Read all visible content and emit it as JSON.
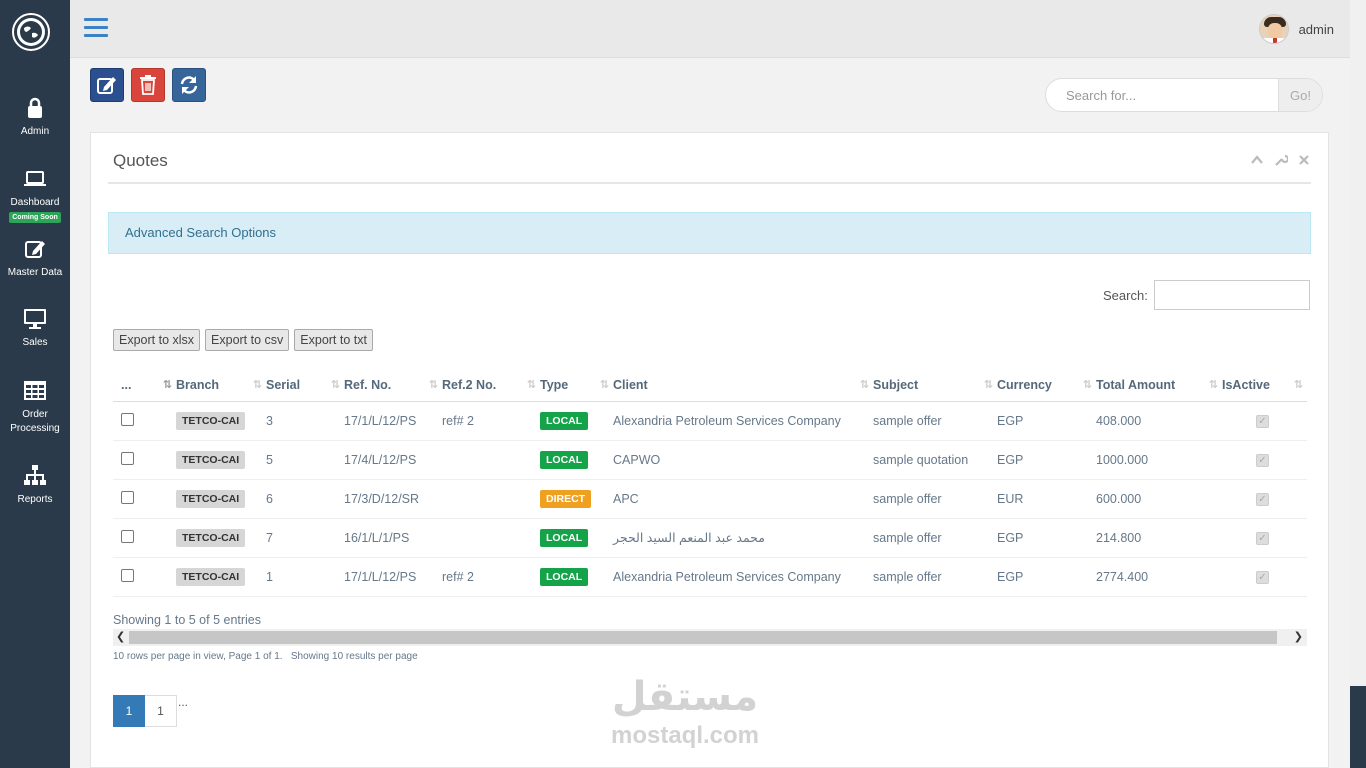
{
  "sidebar": {
    "items": [
      {
        "label": "Admin",
        "icon": "lock-icon"
      },
      {
        "label": "Dashboard",
        "badge": "Coming Soon",
        "icon": "laptop-icon"
      },
      {
        "label": "Master Data",
        "icon": "edit-icon"
      },
      {
        "label": "Sales",
        "icon": "monitor-icon"
      },
      {
        "label": "Order Processing",
        "icon": "table-icon"
      },
      {
        "label": "Reports",
        "icon": "sitemap-icon"
      }
    ]
  },
  "topbar": {
    "username": "admin"
  },
  "search": {
    "placeholder": "Search for...",
    "go_label": "Go!"
  },
  "panel": {
    "title": "Quotes",
    "advanced_search": "Advanced Search Options",
    "table_search_label": "Search:",
    "exports": [
      "Export to xlsx",
      "Export to csv",
      "Export to txt"
    ]
  },
  "table": {
    "columns": [
      "...",
      "Branch",
      "Serial",
      "Ref. No.",
      "Ref.2 No.",
      "Type",
      "Client",
      "Subject",
      "Currency",
      "Total Amount",
      "IsActive"
    ],
    "rows": [
      {
        "branch": "TETCO-CAI",
        "serial": "3",
        "ref": "17/1/L/12/PS",
        "ref2": "ref# 2",
        "type": "LOCAL",
        "client": "Alexandria Petroleum Services Company",
        "subject": "sample offer",
        "currency": "EGP",
        "total": "408.000"
      },
      {
        "branch": "TETCO-CAI",
        "serial": "5",
        "ref": "17/4/L/12/PS",
        "ref2": "",
        "type": "LOCAL",
        "client": "CAPWO",
        "subject": "sample quotation",
        "currency": "EGP",
        "total": "1000.000"
      },
      {
        "branch": "TETCO-CAI",
        "serial": "6",
        "ref": "17/3/D/12/SR",
        "ref2": "",
        "type": "DIRECT",
        "client": "APC",
        "subject": "sample offer",
        "currency": "EUR",
        "total": "600.000"
      },
      {
        "branch": "TETCO-CAI",
        "serial": "7",
        "ref": "16/1/L/1/PS",
        "ref2": "",
        "type": "LOCAL",
        "client": "محمد عبد المنعم السيد الحجر",
        "subject": "sample offer",
        "currency": "EGP",
        "total": "214.800"
      },
      {
        "branch": "TETCO-CAI",
        "serial": "1",
        "ref": "17/1/L/12/PS",
        "ref2": "ref# 2",
        "type": "LOCAL",
        "client": "Alexandria Petroleum Services Company",
        "subject": "sample offer",
        "currency": "EGP",
        "total": "2774.400"
      }
    ],
    "type_colors": {
      "LOCAL": "#15a34a",
      "DIRECT": "#f0a020"
    }
  },
  "footer": {
    "showing": "Showing 1 to 5 of 5 entries",
    "paging_info": "10 rows per page in view, Page 1 of 1.   Showing 10 results per page",
    "pages": [
      "1",
      "1"
    ],
    "ellipsis": "..."
  },
  "watermark": {
    "arabic": "مستقل",
    "latin": "mostaql.com"
  }
}
